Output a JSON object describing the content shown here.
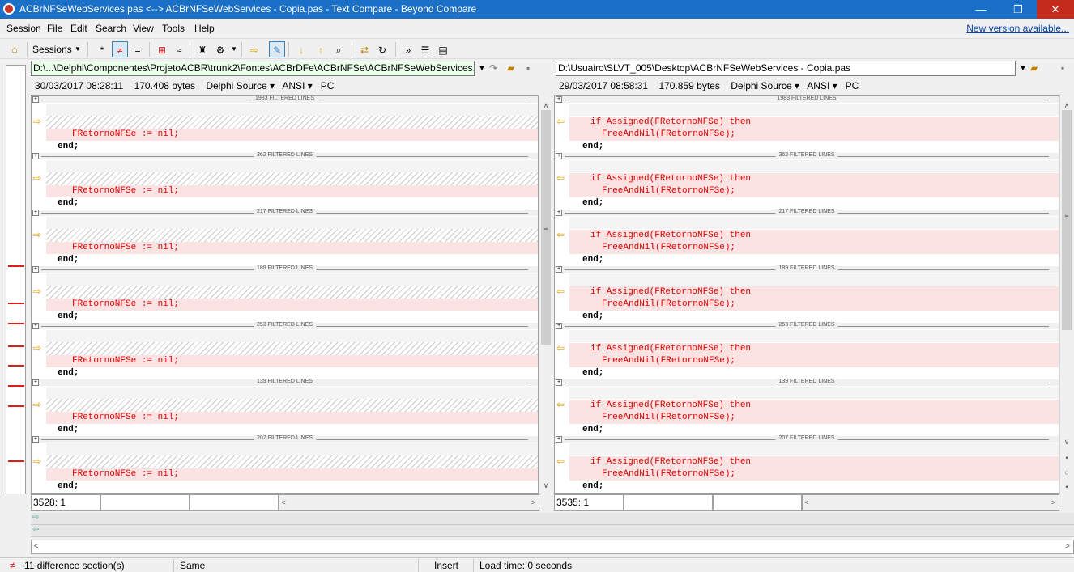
{
  "window": {
    "title": "ACBrNFSeWebServices.pas <--> ACBrNFSeWebServices - Copia.pas - Text Compare - Beyond Compare"
  },
  "menu": {
    "items": [
      "Session",
      "File",
      "Edit",
      "Search",
      "View",
      "Tools",
      "Help"
    ],
    "new_version": "New version available..."
  },
  "toolbar": {
    "sessions_label": "Sessions"
  },
  "left": {
    "path": "D:\\...\\Delphi\\Componentes\\ProjetoACBR\\trunk2\\Fontes\\ACBrDFe\\ACBrNFSe\\ACBrNFSeWebServices.pas",
    "info": {
      "datetime": "30/03/2017 08:28:11",
      "size": "170.408 bytes",
      "format": "Delphi Source",
      "encoding": "ANSI",
      "lineend": "PC"
    },
    "code_line1": "FRetornoNFSe := nil;",
    "code_end": "end;",
    "position": "3528: 1"
  },
  "right": {
    "path": "D:\\Usuairo\\SLVT_005\\Desktop\\ACBrNFSeWebServices - Copia.pas",
    "info": {
      "datetime": "29/03/2017 08:58:31",
      "size": "170.859 bytes",
      "format": "Delphi Source",
      "encoding": "ANSI",
      "lineend": "PC"
    },
    "code_line1": "if Assigned(FRetornoNFSe) then",
    "code_line2": "FreeAndNil(FRetornoNFSe);",
    "code_end": "end;",
    "position": "3535: 1"
  },
  "sections": [
    "1983 FILTERED LINES",
    "362 FILTERED LINES",
    "217 FILTERED LINES",
    "189 FILTERED LINES",
    "253 FILTERED LINES",
    "139 FILTERED LINES",
    "207 FILTERED LINES"
  ],
  "status": {
    "diff_count": "11 difference section(s)",
    "same": "Same",
    "mode": "Insert",
    "load_time": "Load time: 0 seconds"
  },
  "colors": {
    "diff_bg": "#fbe3e3",
    "diff_text": "#e00000",
    "title_bg": "#1a6fc6",
    "path_left_bg": "#eaffea"
  }
}
